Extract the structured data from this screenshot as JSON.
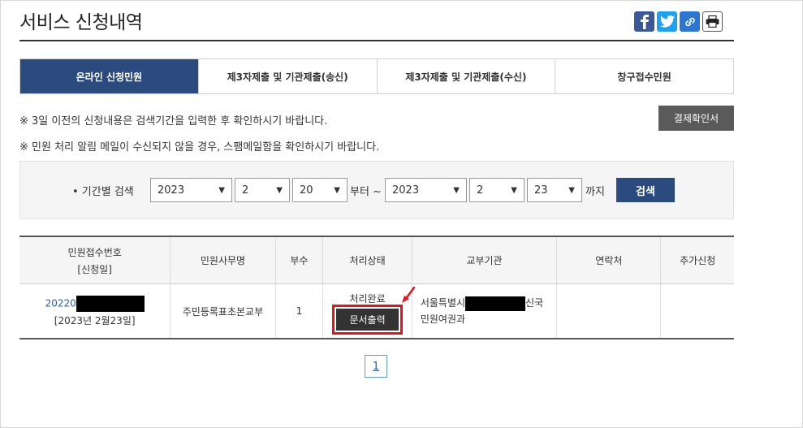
{
  "page": {
    "title": "서비스 신청내역"
  },
  "share": {
    "icons": [
      "facebook-icon",
      "twitter-icon",
      "link-icon",
      "print-icon"
    ]
  },
  "tabs": [
    {
      "label": "온라인 신청민원",
      "active": true
    },
    {
      "label": "제3자제출 및 기관제출(송신)",
      "active": false
    },
    {
      "label": "제3자제출 및 기관제출(수신)",
      "active": false
    },
    {
      "label": "창구접수민원",
      "active": false
    }
  ],
  "notices": [
    "※ 3일 이전의 신청내용은 검색기간을 입력한 후 확인하시기 바랍니다.",
    "※ 민원 처리 알림 메일이 수신되지 않을 경우, 스팸메일함을 확인하시기 바랍니다."
  ],
  "receipt_button": "결제확인서",
  "search": {
    "label": "• 기간별 검색",
    "from_year": "2023",
    "from_month": "2",
    "from_day": "20",
    "from_text": "부터 ~",
    "to_year": "2023",
    "to_month": "2",
    "to_day": "23",
    "to_text": "까지",
    "button": "검색"
  },
  "table": {
    "headers": {
      "receipt_no_line1": "민원접수번호",
      "receipt_no_line2": "[신청일]",
      "service": "민원사무명",
      "copies": "부수",
      "status": "처리상태",
      "agency": "교부기관",
      "contact": "연락처",
      "extra": "추가신청"
    },
    "rows": [
      {
        "receipt_prefix": "20220",
        "date": "[2023년 2월23일]",
        "service": "주민등록표초본교부",
        "copies": "1",
        "status": "처리완료",
        "print_button": "문서출력",
        "agency_prefix": "서울특별시",
        "agency_suffix": "신국",
        "agency_line2": "민원여권과",
        "contact": "",
        "extra": ""
      }
    ]
  },
  "pagination": {
    "current": "1"
  },
  "colors": {
    "primary": "#2b4a7e",
    "highlight": "#e8121a",
    "dark_button": "#5a5a5a"
  }
}
